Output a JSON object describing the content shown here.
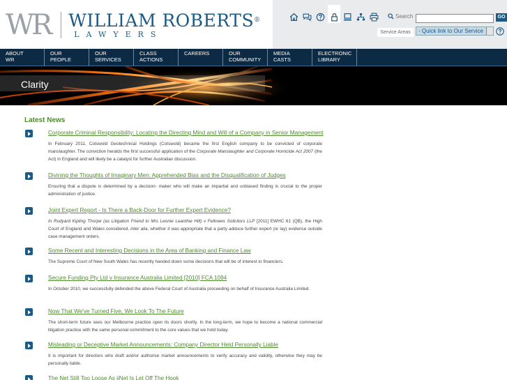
{
  "logo": {
    "mark": "WR",
    "name": "WILLIAM ROBERTS",
    "registered": "®",
    "subtitle": "LAWYERS"
  },
  "utility": {
    "icons": [
      "home-icon",
      "chat-icon",
      "help-icon",
      "lock-icon",
      "computer-icon",
      "sitemap-icon",
      "print-icon"
    ],
    "search_label": "Search",
    "search_value": "",
    "go_label": "GO",
    "service_areas_label": "Service Areas",
    "quick_link_value": "- Quick link to Our Service",
    "help_icon": "help-circle-icon"
  },
  "nav": {
    "items": [
      "ABOUT\nWR",
      "OUR\nPEOPLE",
      "OUR\nSERVICES",
      "CLASS\nACTIONS",
      "CAREERS",
      "OUR\nCOMMUNITY",
      "MEDIA\nCASTS",
      "ELECTRONIC\nLIBRARY"
    ]
  },
  "banner": {
    "title": "Clarity"
  },
  "news": {
    "heading": "Latest News",
    "items": [
      {
        "title": "Corporate Criminal Responsibility: Locating the Directing Mind and Will of a Company in Senior Management",
        "desc_parts": [
          {
            "t": "In February 2011, Cotswold Geotechnical Holdings (Cotswold) became the first English company to be convicted of corporate manslaughter. The conviction heralds the first successful application of the "
          },
          {
            "t": "Corporate Manslaughter and Corporate Homicide Act 2007",
            "i": true
          },
          {
            "t": " (the Act) in England and will likely be a catalyst for further Australian discussion."
          }
        ]
      },
      {
        "title": "Divining the Thoughts of Imaginary Men: Apprehended Bias and the Disqualification of Judges",
        "desc_parts": [
          {
            "t": "Ensuring that a dispute is determined by a decision- maker who will make an impartial and unbiased finding is crucial to the proper administration of justice."
          }
        ]
      },
      {
        "title": "Joint Expert Report - Is There a Back-Door for Further Expert Evidence?",
        "desc_parts": [
          {
            "t": "In Rudyard Kipling Thorpe (as Litigation Friend to Mrs Leonie Leanthie Hill) v Fellowes Solicitors LLP",
            "i": true
          },
          {
            "t": " [2011] EWHC 61 (QB), the High Court of England and Wales considered, "
          },
          {
            "t": "inter alia",
            "i": true
          },
          {
            "t": ", whether it was appropriate that a party adduce further expert (or lay) evidence outside case management orders."
          }
        ]
      },
      {
        "title": "Some Recent and Interesting Decisions in the Area of Banking and Finance Law",
        "desc_parts": [
          {
            "t": "The Supreme Court of New South Wales has recently handed down some decisions that will be of interest to financiers."
          }
        ]
      },
      {
        "title": "Secure Funding Pty Ltd v Insurance Australia Limited [2010] FCA 1094",
        "desc_parts": [
          {
            "t": "In October 2010, we successfully defended the above Federal Court of Australia proceeding on behalf of Insurance Australia Limited."
          }
        ]
      },
      {
        "title": "Now That We've Turned Five, We Look To The Future",
        "desc_parts": [
          {
            "t": "The short-term future sees our Melbourne practice open its doors shortly. In the long-term, we hope to become a national commercial litigation practice with the same personal commitment to the core values that we hold today."
          }
        ]
      },
      {
        "title": "Misleading or Deceptive Market Announcements: Company Director Held Personally Liable",
        "desc_parts": [
          {
            "t": "It is important for directors who draft and/or authorise market announcements to verify accuracy and validity, otherwise they may be personally liable."
          }
        ]
      },
      {
        "title": "The Net Still Too Loose As iiNet Is Let Off The Hook",
        "desc_parts": []
      }
    ]
  },
  "colors": {
    "brand_blue": "#1c5a86",
    "nav_bg": "#0d2a45",
    "link_green": "#4e8a2e"
  }
}
